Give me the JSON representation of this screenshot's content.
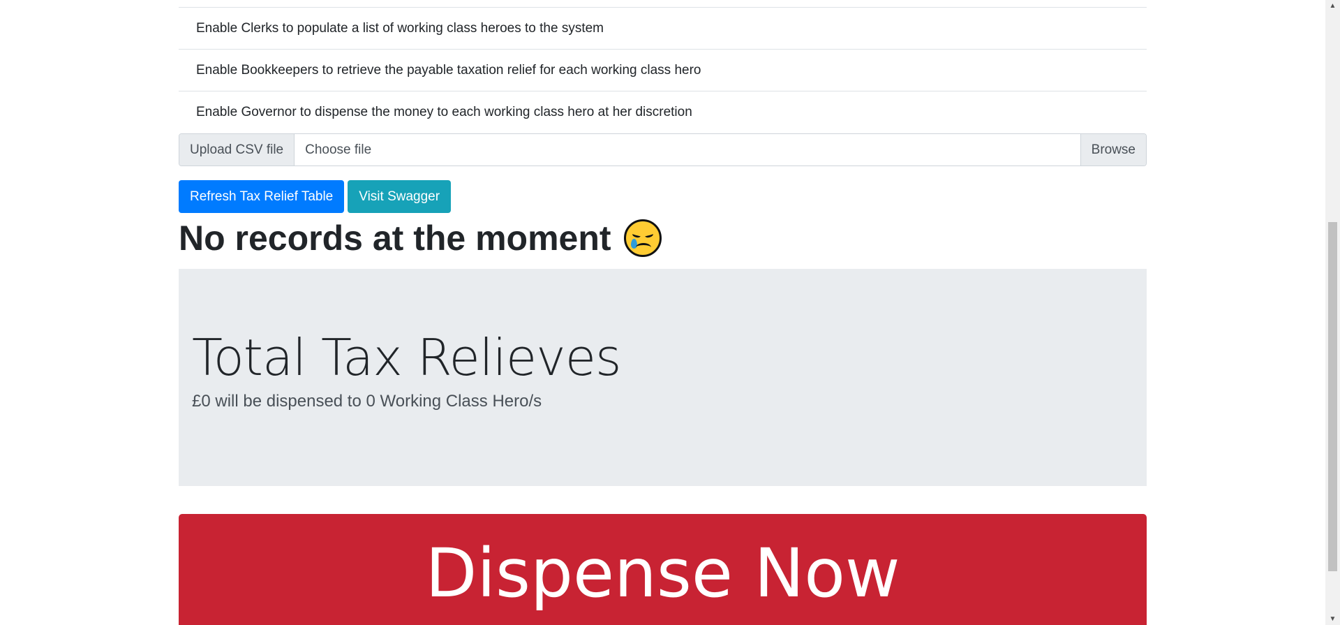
{
  "requirements": [
    "Enable Clerks to populate a list of working class heroes to the system",
    "Enable Bookkeepers to retrieve the payable taxation relief for each working class hero",
    "Enable Governor to dispense the money to each working class hero at her discretion"
  ],
  "upload": {
    "prepend_label": "Upload CSV file",
    "placeholder": "Choose file",
    "browse_label": "Browse"
  },
  "buttons": {
    "refresh_label": "Refresh Tax Relief Table",
    "swagger_label": "Visit Swagger"
  },
  "no_records": {
    "text": "No records at the moment",
    "emoji": "crying-face-icon"
  },
  "summary": {
    "title": "Total Tax Relieves",
    "lead": "£0 will be dispensed to 0 Working Class Hero/s"
  },
  "dispense": {
    "label": "Dispense Now"
  },
  "colors": {
    "primary": "#007bff",
    "info": "#17a2b8",
    "danger": "#c82333",
    "jumbotron_bg": "#e9ecef"
  }
}
